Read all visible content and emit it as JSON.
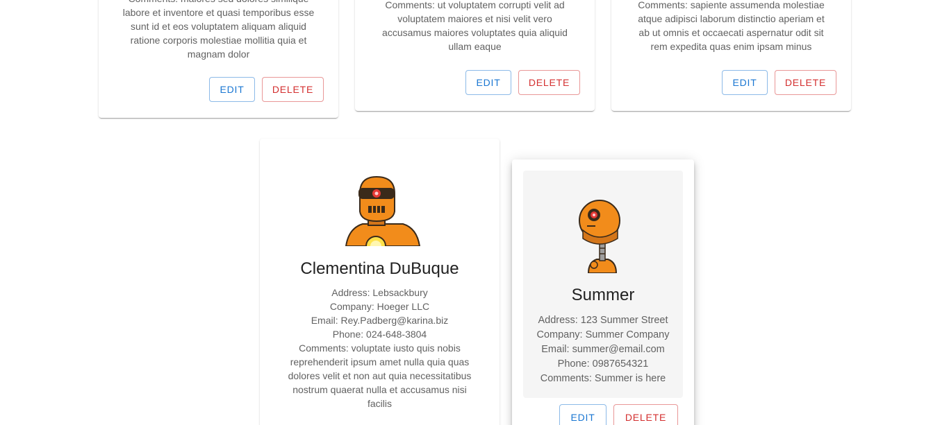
{
  "cards": [
    {
      "comments_lines": [
        "Comments: maiores sed dolores similique",
        "labore et inventore et quasi temporibus esse",
        "sunt id et eos voluptatem aliquam aliquid",
        "ratione corporis molestiae mollitia quia et",
        "magnam dolor"
      ],
      "edit_label": "EDIT",
      "delete_label": "DELETE"
    },
    {
      "comments_lines": [
        "Comments: ut voluptatem corrupti velit ad",
        "voluptatem maiores et nisi velit vero",
        "accusamus maiores voluptates quia aliquid",
        "ullam eaque"
      ],
      "edit_label": "EDIT",
      "delete_label": "DELETE"
    },
    {
      "comments_lines": [
        "Comments: sapiente assumenda molestiae",
        "atque adipisci laborum distinctio aperiam et",
        "ab ut omnis et occaecati aspernatur odit sit",
        "rem expedita quas enim ipsam minus"
      ],
      "edit_label": "EDIT",
      "delete_label": "DELETE"
    },
    {
      "name": "Clementina DuBuque",
      "address": "Address: Lebsackbury",
      "company": "Company: Hoeger LLC",
      "email": "Email: Rey.Padberg@karina.biz",
      "phone": "Phone: 024-648-3804",
      "comments_lines": [
        "Comments: voluptate iusto quis nobis",
        "reprehenderit ipsum amet nulla quia quas",
        "dolores velit et non aut quia necessitatibus",
        "nostrum quaerat nulla et accusamus nisi",
        "facilis"
      ]
    },
    {
      "name": "Summer",
      "address": "Address: 123 Summer Street",
      "company": "Company: Summer Company",
      "email": "Email: summer@email.com",
      "phone": "Phone: 0987654321",
      "comments": "Comments: Summer is here",
      "edit_label": "EDIT",
      "delete_label": "DELETE"
    }
  ],
  "colors": {
    "edit": "#1976d2",
    "delete": "#d32f2f",
    "robot_orange": "#f28c1b",
    "robot_dark": "#3a2a1a",
    "highlight_bg": "#f5f5f5"
  }
}
